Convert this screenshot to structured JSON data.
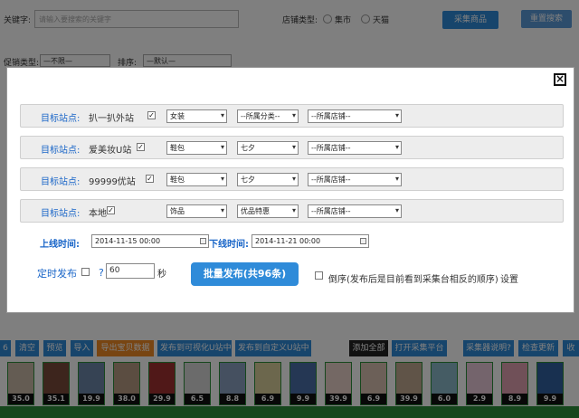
{
  "bg": {
    "keyword_label": "关键字:",
    "keyword_placeholder": "请输入要搜索的关键字",
    "shop_type_label": "店铺类型:",
    "shop_types": [
      "集市",
      "天猫"
    ],
    "collect_btn": "采集商品",
    "reset_btn": "重置搜索",
    "promo_label": "促销类型:",
    "promo_value": "—不限—",
    "sort_label": "排序:",
    "sort_value": "—默认—"
  },
  "toolbar": {
    "items": [
      {
        "label": "6",
        "style": "blue"
      },
      {
        "label": "清空",
        "style": "blue"
      },
      {
        "label": "预览",
        "style": "blue"
      },
      {
        "label": "导入",
        "style": "blue"
      },
      {
        "label": "导出宝贝数据",
        "style": "orange"
      },
      {
        "label": "发布到可视化U站中",
        "style": "blue"
      },
      {
        "label": "发布到自定义U站中",
        "style": "blue"
      },
      {
        "label": "添加全部",
        "style": "dark"
      },
      {
        "label": "打开采集平台",
        "style": "blue"
      },
      {
        "label": "采集器说明?",
        "style": "blue"
      },
      {
        "label": "检查更新",
        "style": "blue"
      },
      {
        "label": "收",
        "style": "blue"
      }
    ]
  },
  "thumbs": {
    "prices": [
      "35.0",
      "35.1",
      "19.9",
      "38.0",
      "29.9",
      "6.5",
      "8.8",
      "6.9",
      "9.9",
      "39.9",
      "6.9",
      "39.9",
      "6.0",
      "2.9",
      "8.9",
      "9.9"
    ],
    "colors": [
      "#c9b8a6",
      "#7a4a3a",
      "#6c87a8",
      "#b79a82",
      "#a03030",
      "#d6d6d6",
      "#8aa0c0",
      "#d9cf9a",
      "#4a6fa8",
      "#e8d0c8",
      "#d8c0b0",
      "#c0a890",
      "#8ab8c8",
      "#e9c8d8",
      "#e0a0b0",
      "#3060a0"
    ]
  },
  "modal": {
    "close_icon": "close-icon",
    "sites": [
      {
        "label": "目标站点:",
        "name": "扒一扒外站",
        "cat1": "女装",
        "cat2": "--所属分类--",
        "cat3": "--所属店铺--"
      },
      {
        "label": "目标站点:",
        "name": "爱美妆U站",
        "cat1": "鞋包",
        "cat2": "七夕",
        "cat3": "--所属店铺--"
      },
      {
        "label": "目标站点:",
        "name": "99999优站",
        "cat1": "鞋包",
        "cat2": "七夕",
        "cat3": "--所属店铺--"
      },
      {
        "label": "目标站点:",
        "name": "本地",
        "cat1": "饰品",
        "cat2": "优品特惠",
        "cat3": "--所属店铺--"
      }
    ],
    "online_label": "上线时间:",
    "online_value": "2014-11-15 00:00",
    "offline_label": "下线时间:",
    "offline_value": "2014-11-21 00:00",
    "timed_label": "定时发布",
    "help_mark": "?",
    "interval_value": "60",
    "seconds_label": "秒",
    "publish_btn": "批量发布(共96条)",
    "reverse_label": "倒序(发布后是目前看到采集台相反的顺序)",
    "settings_link": "设置"
  }
}
